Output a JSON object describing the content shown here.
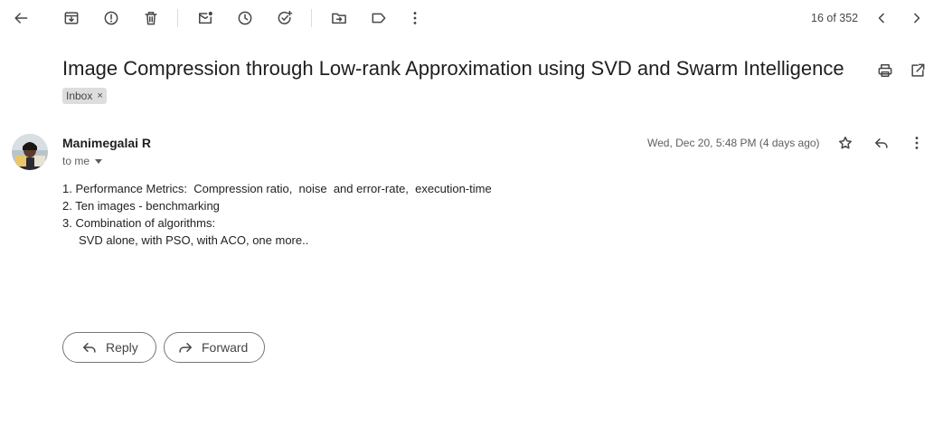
{
  "toolbar": {
    "back": "back-arrow-icon",
    "archive": "archive-icon",
    "spam": "report-spam-icon",
    "delete": "trash-icon",
    "mark_unread": "mark-unread-icon",
    "snooze": "snooze-clock-icon",
    "add_task": "add-task-icon",
    "move": "move-to-folder-icon",
    "labels": "label-icon",
    "more": "more-vert-icon",
    "counter": "16 of 352",
    "prev": "chevron-left-icon",
    "next": "chevron-right-icon"
  },
  "email": {
    "subject": "Image Compression through Low-rank Approximation using SVD and Swarm Intelligence",
    "label": "Inbox",
    "label_close": "×",
    "sender": "Manimegalai R",
    "recipient_summary": "to me",
    "date": "Wed, Dec 20, 5:48 PM (4 days ago)",
    "body_lines": [
      "1. Performance Metrics:  Compression ratio,  noise  and error-rate,  execution-time",
      "2. Ten images - benchmarking",
      "3. Combination of algorithms:",
      "SVD alone, with PSO, with ACO, one more.."
    ]
  },
  "actions": {
    "reply_label": "Reply",
    "forward_label": "Forward"
  },
  "colors": {
    "icon": "#444746",
    "chip_bg": "#dddddd",
    "text": "#1f1f1f",
    "muted": "#5e5e5e"
  }
}
